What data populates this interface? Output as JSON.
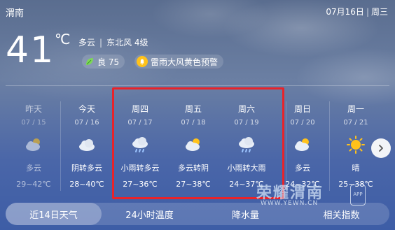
{
  "header": {
    "city": "渭南",
    "date": "07月16日",
    "weekday": "周三"
  },
  "current": {
    "temperature": "41",
    "unit": "℃",
    "condition": "多云",
    "separator": "|",
    "wind": "东北风 4级",
    "aqi_label": "良 75",
    "alert_label": "雷雨大风黄色预警"
  },
  "forecast": [
    {
      "weekday": "昨天",
      "date": "07 / 15",
      "icon": "partly-cloudy-icon",
      "desc": "多云",
      "range": "29~42℃"
    },
    {
      "weekday": "今天",
      "date": "07 / 16",
      "icon": "cloudy-icon",
      "desc": "阴转多云",
      "range": "28~40℃"
    },
    {
      "weekday": "周四",
      "date": "07 / 17",
      "icon": "rain-icon",
      "desc": "小雨转多云",
      "range": "27~36℃"
    },
    {
      "weekday": "周五",
      "date": "07 / 18",
      "icon": "partly-cloudy-icon",
      "desc": "多云转阴",
      "range": "27~38℃"
    },
    {
      "weekday": "周六",
      "date": "07 / 19",
      "icon": "rain-icon",
      "desc": "小雨转大雨",
      "range": "24~37℃"
    },
    {
      "weekday": "周日",
      "date": "07 / 20",
      "icon": "partly-cloudy-icon",
      "desc": "多云",
      "range": "24~32℃"
    },
    {
      "weekday": "周一",
      "date": "07 / 21",
      "icon": "sunny-icon",
      "desc": "晴",
      "range": "25~38℃"
    }
  ],
  "tabs": [
    {
      "label": "近14日天气",
      "active": true
    },
    {
      "label": "24小时温度",
      "active": false
    },
    {
      "label": "降水量",
      "active": false
    },
    {
      "label": "相关指数",
      "active": false
    }
  ],
  "watermark": {
    "brand": "荣耀渭南",
    "site": "WWW.YEWN.CN",
    "badge": "APP"
  },
  "colors": {
    "highlight_border": "#e8232a",
    "sun": "#ffc21a",
    "rain": "#9cc4ff"
  }
}
